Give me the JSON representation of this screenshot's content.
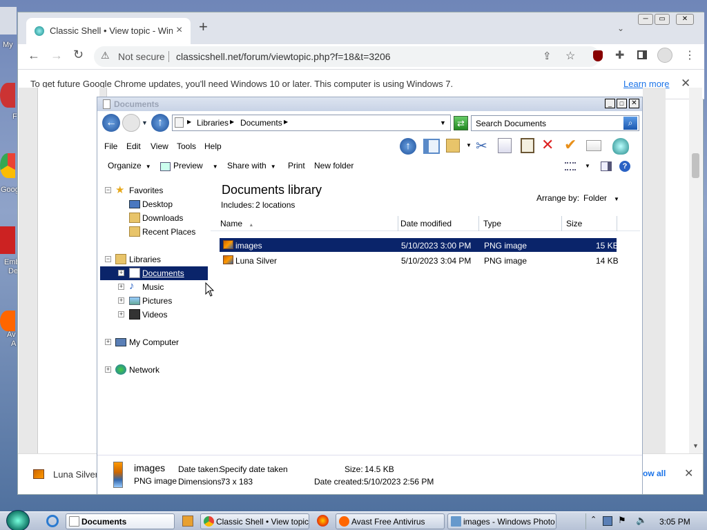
{
  "desktop": {
    "labels": [
      "My",
      "F",
      "Goog",
      "Emb",
      "De",
      "Av",
      "A"
    ]
  },
  "chrome": {
    "tab_title": "Classic Shell • View topic - Windo",
    "security_label": "Not secure",
    "url": "classicshell.net/forum/viewtopic.php?f=18&t=3206",
    "infobar_text": "To get future Google Chrome updates, you'll need Windows 10 or later. This computer is using Windows 7.",
    "learn_more": "Learn more",
    "colors": {
      "tabstrip": "#dfe3eb",
      "link": "#1a73e8"
    }
  },
  "explorer": {
    "title": "Documents",
    "breadcrumb": [
      "Libraries",
      "Documents"
    ],
    "search_placeholder": "Search Documents",
    "menu": [
      "File",
      "Edit",
      "View",
      "Tools",
      "Help"
    ],
    "commands": {
      "organize": "Organize",
      "preview": "Preview",
      "share_with": "Share with",
      "print": "Print",
      "new_folder": "New folder"
    },
    "nav": {
      "favorites": "Favorites",
      "desktop": "Desktop",
      "downloads": "Downloads",
      "recent": "Recent Places",
      "libraries": "Libraries",
      "documents": "Documents",
      "music": "Music",
      "pictures": "Pictures",
      "videos": "Videos",
      "computer": "My Computer",
      "network": "Network"
    },
    "library_title": "Documents library",
    "includes_label": "Includes:",
    "includes_value": "2 locations",
    "arrange_label": "Arrange by:",
    "arrange_value": "Folder",
    "columns": [
      "Name",
      "Date modified",
      "Type",
      "Size"
    ],
    "files": [
      {
        "name": "images",
        "date": "5/10/2023 3:00 PM",
        "type": "PNG image",
        "size": "15 KB",
        "selected": true
      },
      {
        "name": "Luna Silver",
        "date": "5/10/2023 3:04 PM",
        "type": "PNG image",
        "size": "14 KB",
        "selected": false
      }
    ],
    "details": {
      "name": "images",
      "type": "PNG image",
      "date_taken_label": "Date taken:",
      "date_taken": "Specify date taken",
      "dimensions_label": "Dimensions:",
      "dimensions": "73 x 183",
      "size_label": "Size:",
      "size": "14.5 KB",
      "created_label": "Date created:",
      "created": "5/10/2023 2:56 PM"
    },
    "selection_color": "#0a246a"
  },
  "download_bar": {
    "item": "Luna Silver",
    "show_all": "ow all"
  },
  "taskbar": {
    "tasks": [
      "Documents",
      "Classic Shell • View topic ...",
      "Avast Free Antivirus",
      "images - Windows Photo ..."
    ],
    "clock": "3:05 PM"
  }
}
